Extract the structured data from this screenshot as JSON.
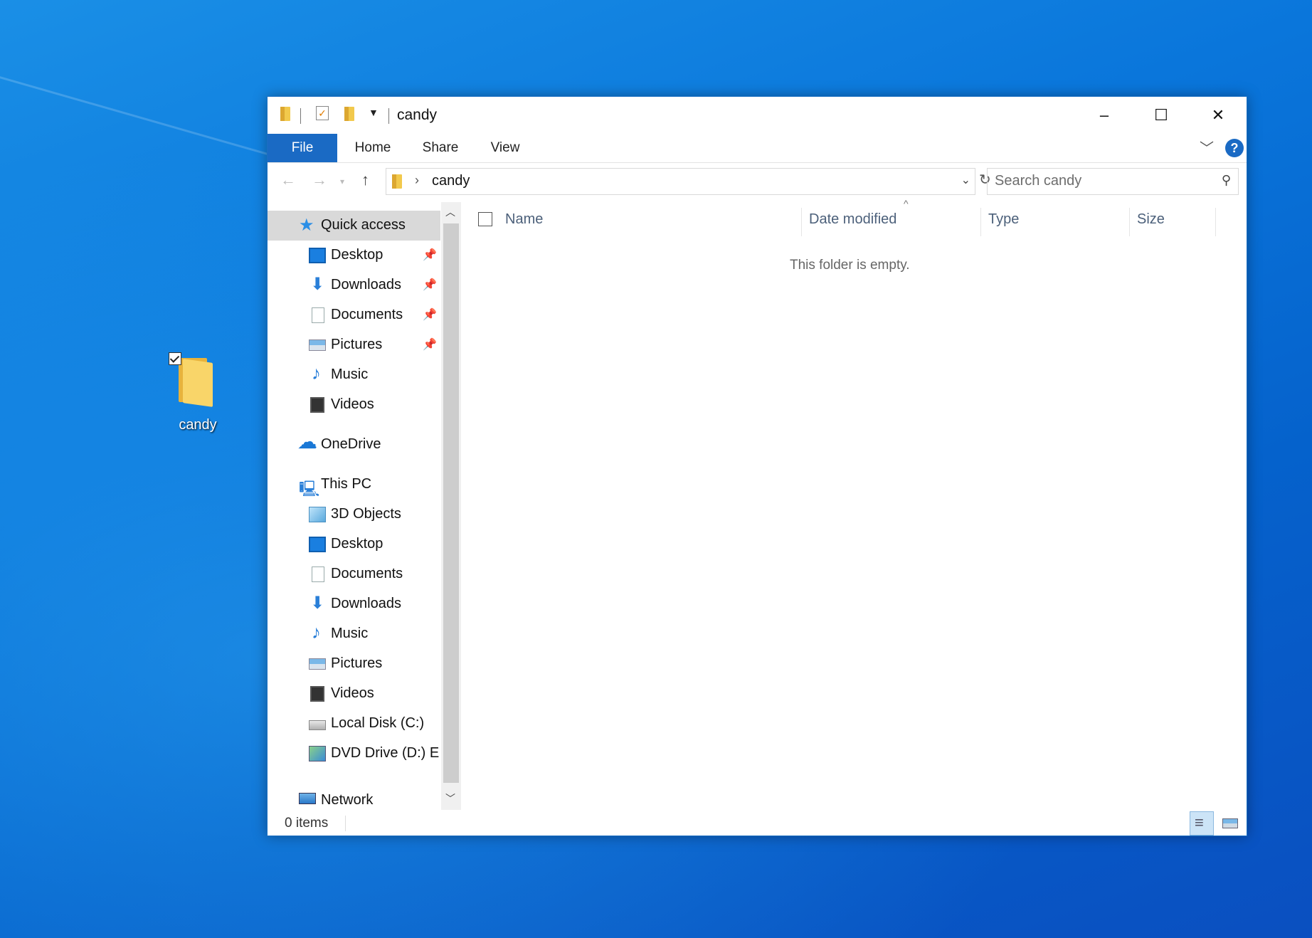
{
  "desktop": {
    "icon_label": "candy"
  },
  "window": {
    "title": "candy",
    "controls": {
      "minimize": "–",
      "maximize": "☐",
      "close": "✕"
    },
    "ribbon": {
      "tabs": [
        "File",
        "Home",
        "Share",
        "View"
      ],
      "help": "?"
    },
    "address": {
      "path": "candy"
    },
    "search": {
      "placeholder": "Search candy"
    },
    "nav_pane": {
      "quick_access": "Quick access",
      "quick_items": [
        "Desktop",
        "Downloads",
        "Documents",
        "Pictures",
        "Music",
        "Videos"
      ],
      "onedrive": "OneDrive",
      "this_pc": "This PC",
      "pc_items": [
        "3D Objects",
        "Desktop",
        "Documents",
        "Downloads",
        "Music",
        "Pictures",
        "Videos",
        "Local Disk (C:)",
        "DVD Drive (D:) E:"
      ],
      "network": "Network"
    },
    "columns": {
      "name": "Name",
      "date_modified": "Date modified",
      "type": "Type",
      "size": "Size"
    },
    "empty_message": "This folder is empty.",
    "status": {
      "items": "0 items"
    }
  }
}
